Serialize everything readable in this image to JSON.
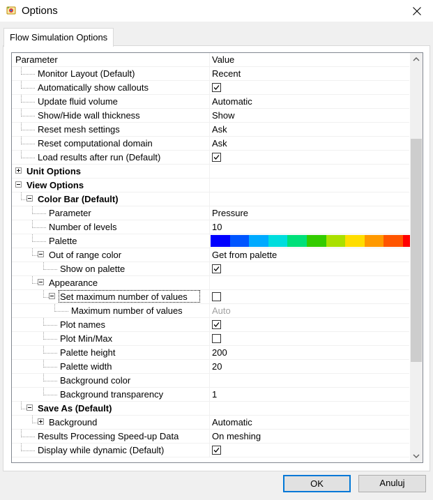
{
  "window": {
    "title": "Options",
    "app_icon": "flow-simulation-icon",
    "close_icon": "close-icon"
  },
  "tabs": [
    {
      "label": "Flow Simulation Options",
      "active": true
    }
  ],
  "grid": {
    "header": {
      "name": "Parameter",
      "value": "Value"
    },
    "rows": [
      {
        "label": "Monitor Layout (Default)",
        "value": "Recent",
        "type": "text"
      },
      {
        "label": "Automatically show callouts",
        "value": "checked",
        "type": "checkbox"
      },
      {
        "label": "Update fluid volume",
        "value": "Automatic",
        "type": "text"
      },
      {
        "label": "Show/Hide wall thickness",
        "value": "Show",
        "type": "text"
      },
      {
        "label": "Reset mesh settings",
        "value": "Ask",
        "type": "text"
      },
      {
        "label": "Reset computational domain",
        "value": "Ask",
        "type": "text"
      },
      {
        "label": "Load results after run (Default)",
        "value": "checked",
        "type": "checkbox"
      },
      {
        "label": "Unit Options",
        "value": "",
        "type": "group",
        "expander": "plus"
      },
      {
        "label": "View Options",
        "value": "",
        "type": "group",
        "expander": "minus"
      },
      {
        "label": "Color Bar (Default)",
        "value": "",
        "type": "group",
        "expander": "minus"
      },
      {
        "label": "Parameter",
        "value": "Pressure",
        "type": "text"
      },
      {
        "label": "Number of levels",
        "value": "10",
        "type": "text"
      },
      {
        "label": "Palette",
        "value": "",
        "type": "palette"
      },
      {
        "label": "Out of range color",
        "value": "Get from palette",
        "type": "text",
        "expander": "minus"
      },
      {
        "label": "Show on palette",
        "value": "checked",
        "type": "checkbox"
      },
      {
        "label": "Appearance",
        "value": "",
        "type": "group-normal",
        "expander": "minus"
      },
      {
        "label": "Set maximum number of values",
        "value": "unchecked",
        "type": "checkbox",
        "expander": "minus",
        "focused": true
      },
      {
        "label": "Maximum number of values",
        "value": "Auto",
        "type": "text-dim"
      },
      {
        "label": "Plot names",
        "value": "checked",
        "type": "checkbox"
      },
      {
        "label": "Plot Min/Max",
        "value": "unchecked",
        "type": "checkbox"
      },
      {
        "label": "Palette height",
        "value": "200",
        "type": "text"
      },
      {
        "label": "Palette width",
        "value": "20",
        "type": "text"
      },
      {
        "label": "Background color",
        "value": "",
        "type": "text"
      },
      {
        "label": "Background transparency",
        "value": "1",
        "type": "text"
      },
      {
        "label": "Save As (Default)",
        "value": "",
        "type": "group",
        "expander": "minus"
      },
      {
        "label": "Background",
        "value": "Automatic",
        "type": "text",
        "expander": "plus"
      },
      {
        "label": "Results Processing Speed-up Data",
        "value": "On meshing",
        "type": "text"
      },
      {
        "label": "Display while dynamic (Default)",
        "value": "checked",
        "type": "checkbox"
      }
    ],
    "palette_colors": [
      "#0000ff",
      "#0055ff",
      "#00aaff",
      "#00dddd",
      "#00e07a",
      "#33cc00",
      "#aae000",
      "#ffdd00",
      "#ff9900",
      "#ff5500",
      "#ff0000"
    ]
  },
  "buttons": {
    "ok": "OK",
    "cancel": "Anuluj"
  },
  "scrollbar": {
    "up_icon": "chevron-up-icon",
    "down_icon": "chevron-down-icon"
  }
}
